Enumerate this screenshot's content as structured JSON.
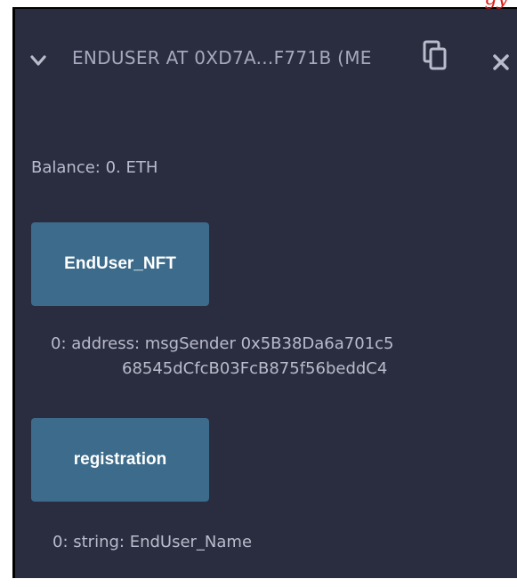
{
  "header": {
    "title": "ENDUSER AT 0XD7A...F771B (ME",
    "collapse_icon": "chevron-down-icon",
    "copy_icon": "copy-icon",
    "close_icon": "close-icon"
  },
  "balance": {
    "text": "Balance: 0. ETH"
  },
  "functions": [
    {
      "label": "EndUser_NFT",
      "output_line1": "0:  address: msgSender 0x5B38Da6a701c5",
      "output_line2": "68545dCfcB03FcB875f56beddC4"
    },
    {
      "label": "registration",
      "output_line1": "0: string: EndUser_Name"
    }
  ],
  "colors": {
    "panel_bg": "#2a2c3f",
    "button_bg": "#3c6b8b",
    "text": "#b9bccc",
    "accent_red": "#e01b1b"
  }
}
